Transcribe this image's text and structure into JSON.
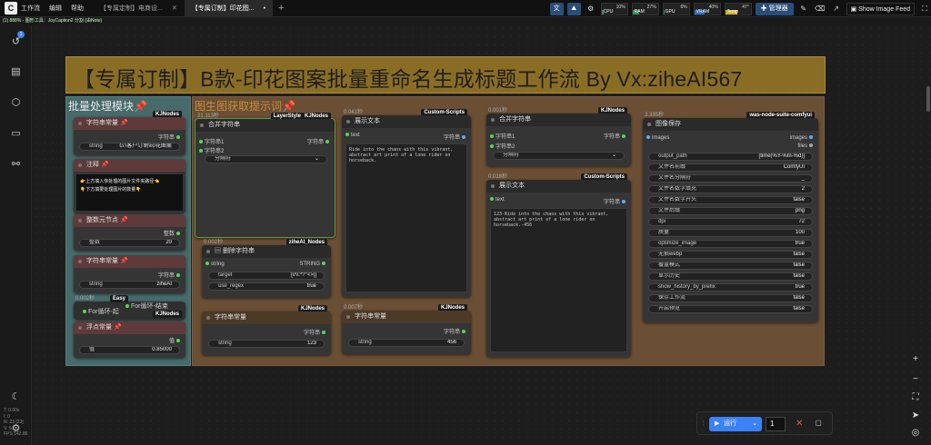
{
  "menu": {
    "items": [
      "工作流",
      "编辑",
      "帮助"
    ]
  },
  "tabs": [
    {
      "label": "【专属定制】电商设...",
      "active": false
    },
    {
      "label": "【专属订制】印花图...",
      "active": true,
      "modified": "•"
    }
  ],
  "toolbar": {
    "manager": "管理器",
    "show_image_feed": "Show Image Feed",
    "monitors": [
      {
        "label": "CPU",
        "value": "10%",
        "fill": 0.1,
        "color": "#2e8b57"
      },
      {
        "label": "RAM",
        "value": "27%",
        "fill": 0.27,
        "color": "#2e8b57"
      },
      {
        "label": "GPU",
        "value": "6%",
        "fill": 0.06,
        "color": "#2e8b57"
      },
      {
        "label": "VRAM",
        "value": "40%",
        "fill": 0.4,
        "color": "#2b6fbf"
      },
      {
        "label": "Temp",
        "value": "47°",
        "fill": 0.47,
        "color": "#c8b22a"
      }
    ]
  },
  "status_line": "(1) 888% - 图形工具：JoyCaption2 分割 (由Note)",
  "sidebar": {
    "badge": "1",
    "info": [
      "T: 0.00s",
      "I: 0",
      "N: 23 [23]",
      "V: 61",
      "FPS:142.86"
    ]
  },
  "canvas": {
    "main_title": "【专属订制】B款-印花图案批量重命名生成标题工作流 By Vx:ziheAI567",
    "group1_title": "批量处理模块",
    "group2_title": "图生图获取提示词",
    "pin": "📌"
  },
  "nodes": {
    "str_const1": {
      "title": "字符串常量",
      "tag": "KJNodes",
      "out": "字符串",
      "k": "string",
      "v": "G:\\客户订制\\印花图案"
    },
    "note": {
      "title": "注释",
      "lines": [
        "👉上方填入你处理的图片文件夹路径👈",
        "👇下方填要处理图片的数量👇"
      ]
    },
    "int_node": {
      "title": "整数元节点",
      "out": "整数",
      "k": "整数",
      "v": "20"
    },
    "str_const2": {
      "title": "字符串常量",
      "out": "字符串",
      "k": "string",
      "v": "ziheAI"
    },
    "easy": {
      "time": "0.002秒",
      "tag": "Easy",
      "tag2": "KJNodes",
      "title": "For循环-起",
      "title2": "For循环-结束"
    },
    "float_const": {
      "title": "浮点常量",
      "out": "值",
      "k": "值",
      "v": "0.85000"
    },
    "concat1": {
      "time": "21.113秒",
      "tag": "LayerStyle",
      "tag2": "KJNodes",
      "title": "合并字符串",
      "in1": "字符串1",
      "in2": "字符串2",
      "out": "字符串",
      "sep": "分隔符"
    },
    "delete_str": {
      "time": "0.002秒",
      "tag": "ziheAI_Nodes",
      "title": "删除字符串",
      "in": "string",
      "out": "STRING",
      "k1": "target",
      "v1": "[\\/\\\\:*?\"<>|]",
      "k2": "use_regex",
      "v2": "true"
    },
    "str_const3": {
      "title": "字符串常量",
      "tag": "KJNodes",
      "out": "字符串",
      "k": "string",
      "v": "123"
    },
    "show1": {
      "time": "0.041秒",
      "tag": "Custom-Scripts",
      "title": "展示文本",
      "in": "text",
      "out": "字符串",
      "content": "Ride into the chaos with this vibrant, abstract art print of a lone rider on horseback."
    },
    "str_const4": {
      "time": "0.007秒",
      "tag": "KJNodes",
      "title": "字符串常量",
      "out": "字符串",
      "k": "string",
      "v": "456"
    },
    "concat2": {
      "time": "0.001秒",
      "tag": "KJNodes",
      "title": "合并字符串",
      "in1": "字符串1",
      "in2": "字符串2",
      "out": "字符串",
      "sep": "分隔符"
    },
    "show2": {
      "time": "0.018秒",
      "tag": "Custom-Scripts",
      "title": "展示文本",
      "in": "text",
      "out": "字符串",
      "content": "123-Ride into the chaos with this vibrant, abstract art print of a lone rider on horseback.-456"
    },
    "save": {
      "time": "3.335秒",
      "tag": "was-node-suite-comfyui",
      "title": "图像保存",
      "in": "images",
      "out1": "images",
      "out2": "files",
      "rows": [
        {
          "k": "output_path",
          "v": "[time(%Y-%m-%d)]"
        },
        {
          "k": "文件名前缀",
          "v": "ComfyUI"
        },
        {
          "k": "文件名分隔符",
          "v": "_"
        },
        {
          "k": "文件名数字填充",
          "v": "2"
        },
        {
          "k": "文件名数字开头",
          "v": "false"
        },
        {
          "k": "文件后缀",
          "v": "png"
        },
        {
          "k": "dpi",
          "v": "72"
        },
        {
          "k": "质量",
          "v": "100"
        },
        {
          "k": "optimize_image",
          "v": "true"
        },
        {
          "k": "无损webp",
          "v": "false"
        },
        {
          "k": "覆盖模式",
          "v": "false"
        },
        {
          "k": "显示历史",
          "v": "false"
        },
        {
          "k": "show_history_by_prefix",
          "v": "true"
        },
        {
          "k": "保存工作流",
          "v": "false"
        },
        {
          "k": "开启预览",
          "v": "false"
        }
      ]
    }
  },
  "runbar": {
    "run_label": "运行",
    "count": "1"
  }
}
